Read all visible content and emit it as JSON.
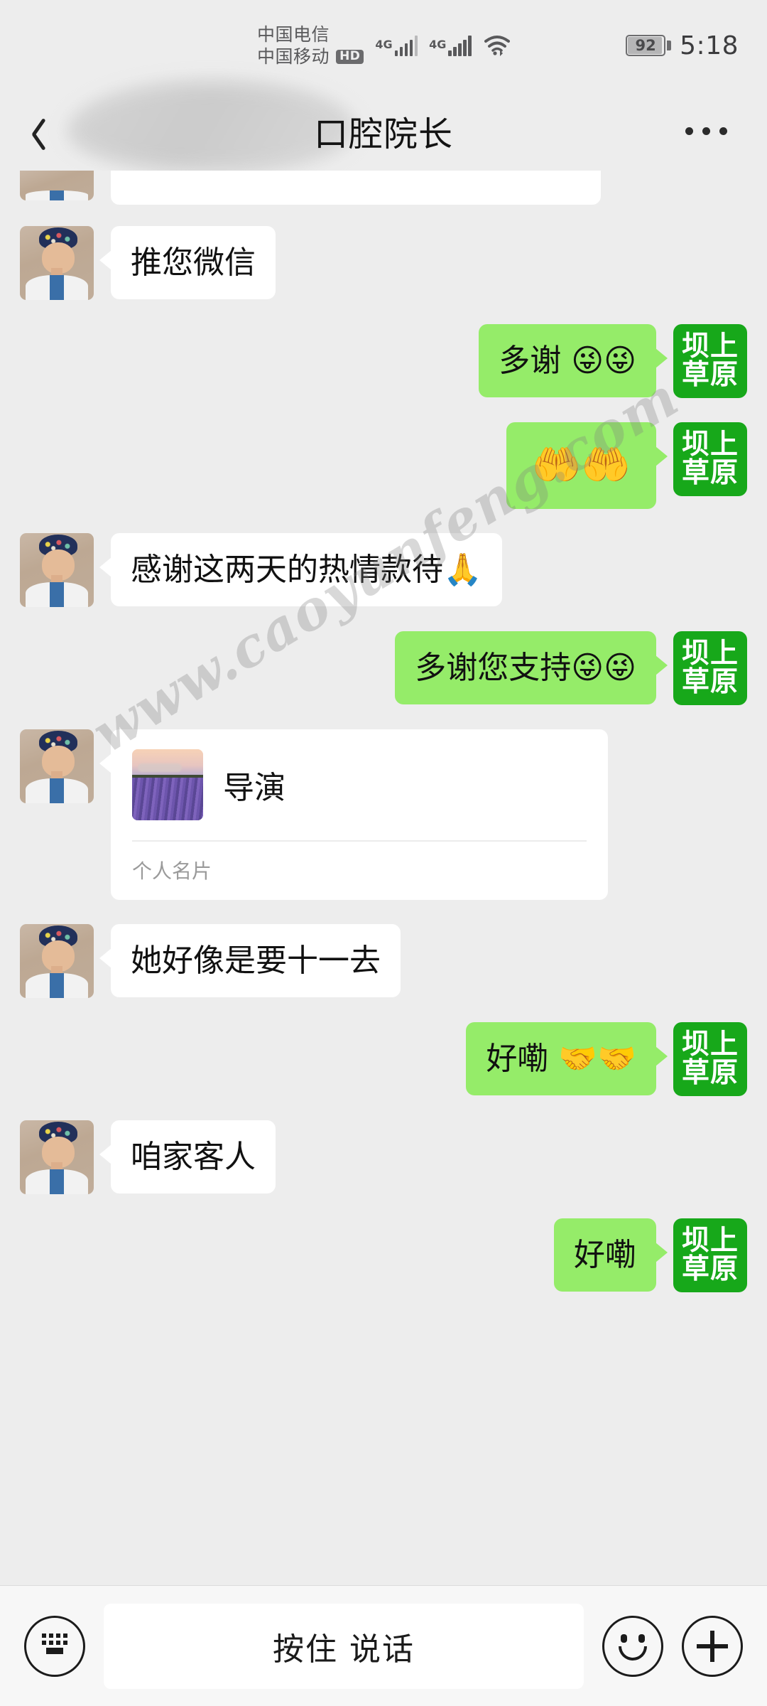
{
  "statusbar": {
    "carrier_primary": "中国电信",
    "carrier_secondary": "中国移动",
    "hd_badge": "HD",
    "network_1": "4G",
    "network_2": "4G",
    "wifi_icon": "wifi-icon",
    "battery_percent": "92",
    "time": "5:18"
  },
  "header": {
    "back_icon": "back-chevron-icon",
    "title": "口腔院长",
    "more_icon": "more-options-icon"
  },
  "brand_avatar": {
    "line1": "坝上",
    "line2": "草原",
    "color": "#17a81a"
  },
  "watermark": "www.caoyunfeng.com",
  "colors": {
    "background": "#ededed",
    "incoming_bubble": "#ffffff",
    "outgoing_bubble": "#95ec69",
    "brand_green": "#17a81a"
  },
  "messages": [
    {
      "id": "m0",
      "side": "in",
      "type": "partial",
      "text": ""
    },
    {
      "id": "m1",
      "side": "in",
      "type": "text",
      "text": "推您微信"
    },
    {
      "id": "m2",
      "side": "out",
      "type": "text",
      "text": "多谢 😜😜"
    },
    {
      "id": "m3",
      "side": "out",
      "type": "emoji",
      "text": "🤲🤲"
    },
    {
      "id": "m4",
      "side": "in",
      "type": "text",
      "text": "感谢这两天的热情款待🙏"
    },
    {
      "id": "m5",
      "side": "out",
      "type": "text",
      "text": "多谢您支持😜😜"
    },
    {
      "id": "m6",
      "side": "in",
      "type": "card",
      "card_name": "导演",
      "card_type": "个人名片"
    },
    {
      "id": "m7",
      "side": "in",
      "type": "text",
      "text": "她好像是要十一去"
    },
    {
      "id": "m8",
      "side": "out",
      "type": "text",
      "text": "好嘞 🤝🤝"
    },
    {
      "id": "m9",
      "side": "in",
      "type": "text",
      "text": "咱家客人"
    },
    {
      "id": "m10",
      "side": "out",
      "type": "text",
      "text": "好嘞"
    }
  ],
  "bottombar": {
    "keyboard_icon": "keyboard-icon",
    "voice_label": "按住 说话",
    "emoji_icon": "smiley-icon",
    "plus_icon": "plus-icon"
  }
}
